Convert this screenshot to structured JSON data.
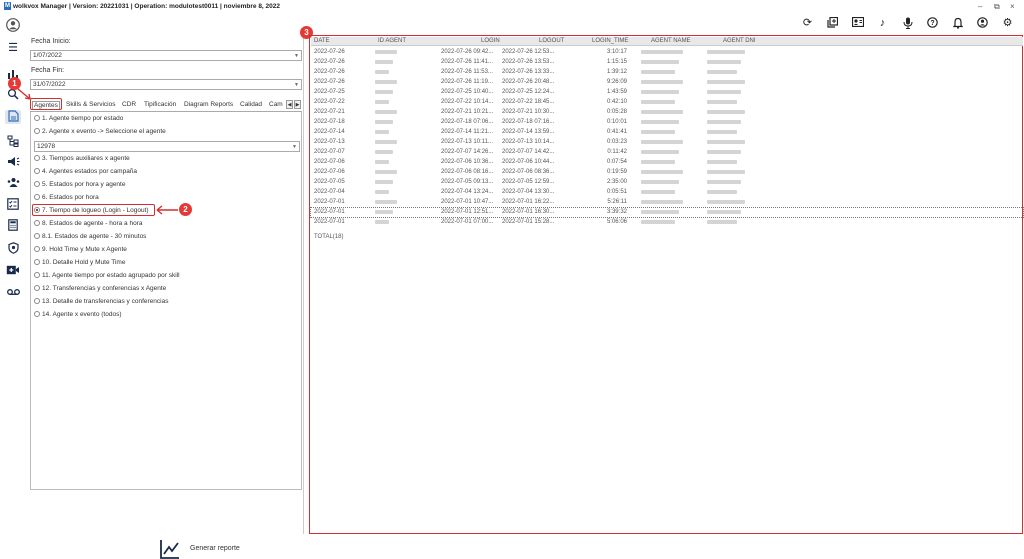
{
  "window": {
    "title": "wolkvox Manager  | Version: 20221031  |  Operation: modulotest0011  |  noviembre 8, 2022",
    "minimize": "–",
    "restore": "⧉",
    "close": "×"
  },
  "toolbar_icons": [
    "refresh-icon",
    "copy-icon",
    "id-card-icon",
    "music-icon",
    "microphone-icon",
    "help-icon",
    "bell-icon",
    "user-icon",
    "gear-icon"
  ],
  "nav_icons": [
    "avatar-icon",
    "menu-icon",
    "chart-icon",
    "search-analytics-icon",
    "report-icon",
    "hierarchy-icon",
    "campaign-icon",
    "agents-icon",
    "checklist-icon",
    "calculator-icon",
    "shield-icon",
    "video-icon",
    "voicemail-icon"
  ],
  "filters": {
    "start_label": "Fecha Inicio:",
    "start_value": "1/07/2022",
    "end_label": "Fecha Fin:",
    "end_value": "31/07/2022"
  },
  "tabs": [
    "Agentes",
    "Skills & Servicios",
    "CDR",
    "Tipificación",
    "Diagram Reports",
    "Calidad",
    "Cam"
  ],
  "reports_top": [
    "1. Agente tiempo por estado",
    "2. Agente x evento -> Seleccione el agente"
  ],
  "agent_combo": "12978",
  "reports": [
    "3. Tiempos auxiliares x agente",
    "4. Agentes estados por campaña",
    "5. Estados por hora y agente",
    "6. Estados por hora",
    "7. Tiempo de logueo (Login - Logout)",
    "8. Estados de agente - hora a hora",
    "8.1. Estados de agente - 30 minutos",
    "9. Hold Time y Mute x Agente",
    "10. Detalle Hold y Mute Time",
    "11. Agente tiempo por estado agrupado por skill",
    "12. Transferencias y conferencias x Agente",
    "13. Detalle de transferencias y conferencias",
    "14. Agente x evento (todos)"
  ],
  "selected_report": "7. Tiempo de logueo (Login - Logout)",
  "generate_button": "Generar reporte",
  "badges": [
    "1",
    "2",
    "3"
  ],
  "table": {
    "columns": [
      "DATE",
      "ID AGENT",
      "LOGIN",
      "LOGOUT",
      "LOGIN_TIME",
      "AGENT NAME",
      "AGENT DNI"
    ],
    "rows": [
      [
        "2022-07-26",
        "2022-07-26 09:42...",
        "2022-07-26 12:53...",
        "3:10:17"
      ],
      [
        "2022-07-26",
        "2022-07-26 11:41...",
        "2022-07-26 13:53...",
        "1:15:15"
      ],
      [
        "2022-07-26",
        "2022-07-26 11:53...",
        "2022-07-26 13:33...",
        "1:39:12"
      ],
      [
        "2022-07-26",
        "2022-07-26 11:19...",
        "2022-07-26 20:48...",
        "9:26:09"
      ],
      [
        "2022-07-25",
        "2022-07-25 10:40...",
        "2022-07-25 12:24...",
        "1:43:59"
      ],
      [
        "2022-07-22",
        "2022-07-22 10:14...",
        "2022-07-22 18:45...",
        "0:42:10"
      ],
      [
        "2022-07-21",
        "2022-07-21 10:21...",
        "2022-07-21 10:30...",
        "0:05:28"
      ],
      [
        "2022-07-18",
        "2022-07-18 07:06...",
        "2022-07-18 07:16...",
        "0:10:01"
      ],
      [
        "2022-07-14",
        "2022-07-14 11:21...",
        "2022-07-14 13:59...",
        "0:41:41"
      ],
      [
        "2022-07-13",
        "2022-07-13 10:11...",
        "2022-07-13 10:14...",
        "0:03:23"
      ],
      [
        "2022-07-07",
        "2022-07-07 14:26...",
        "2022-07-07 14:42...",
        "0:11:42"
      ],
      [
        "2022-07-06",
        "2022-07-06 10:36...",
        "2022-07-06 10:44...",
        "0:07:54"
      ],
      [
        "2022-07-06",
        "2022-07-06 08:16...",
        "2022-07-06 08:36...",
        "0:19:59"
      ],
      [
        "2022-07-05",
        "2022-07-05 09:13...",
        "2022-07-05 12:59...",
        "2:35:00"
      ],
      [
        "2022-07-04",
        "2022-07-04 13:24...",
        "2022-07-04 13:30...",
        "0:05:51"
      ],
      [
        "2022-07-01",
        "2022-07-01 10:47...",
        "2022-07-01 16:22...",
        "5:26:11"
      ],
      [
        "2022-07-01",
        "2022-07-01 12:51...",
        "2022-07-01 16:30...",
        "3:39:32"
      ],
      [
        "2022-07-01",
        "2022-07-01 07:00...",
        "2022-07-01 15:28...",
        "5:06:06"
      ]
    ],
    "total": "TOTAL(18)"
  },
  "colors": {
    "accent": "#d32f2f",
    "nav": "#1a2a4a",
    "header": "#e8e8e8"
  }
}
